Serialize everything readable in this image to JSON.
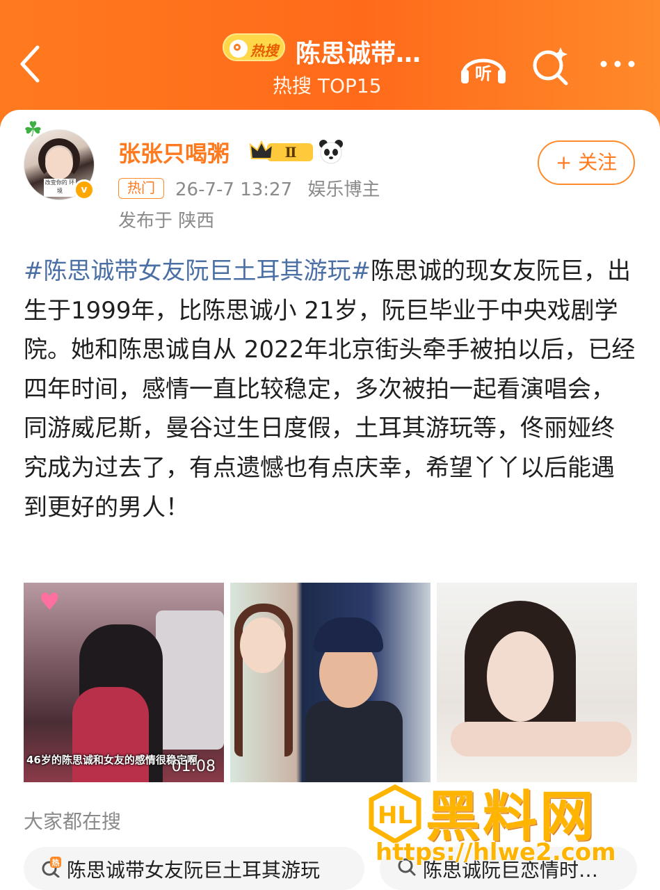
{
  "header": {
    "hot_pill_label": "热搜",
    "title": "陈思诚带…",
    "subtitle": "热搜 TOP15",
    "listen_label": "听"
  },
  "post": {
    "author": "张张只喝粥",
    "vip_level": "Ⅱ",
    "hot_tag": "热门",
    "timestamp": "26-7-7 13:27",
    "author_type": "娱乐博主",
    "location": "发布于 陕西",
    "follow_label": "+ 关注",
    "hashtag": "#陈思诚带女友阮巨土耳其游玩#",
    "body": "陈思诚的现女友阮巨，出生于1999年，比陈思诚小 21岁，阮巨毕业于中央戏剧学院。她和陈思诚自从 2022年北京街头牵手被拍以后，已经四年时间，感情一直比较稳定，多次被拍一起看演唱会，同游威尼斯，曼谷过生日度假，土耳其游玩等，佟丽娅终究成为过去了，有点遗憾也有点庆幸，希望丫丫以后能遇到更好的男人！",
    "avatar_sign": "改变你的 环境"
  },
  "images": [
    {
      "caption": "46岁的陈思诚和女友的感情很稳定啊",
      "duration": "01:08"
    },
    {
      "caption": ""
    },
    {
      "caption": ""
    }
  ],
  "related": {
    "title": "大家都在搜",
    "chips": [
      {
        "icon": "hot-icon",
        "icon_text": "热",
        "label": "陈思诚带女友阮巨土耳其游玩"
      },
      {
        "icon": "search-icon",
        "label": "陈思诚阮巨恋情时…"
      }
    ]
  },
  "watermark": {
    "text": "黑料网",
    "url": "https://hlwe2.com"
  },
  "colors": {
    "header_orange": "#ff7a1f",
    "accent": "#ff7a1f",
    "hashtag": "#4a6fa5",
    "watermark": "#ffb400"
  }
}
